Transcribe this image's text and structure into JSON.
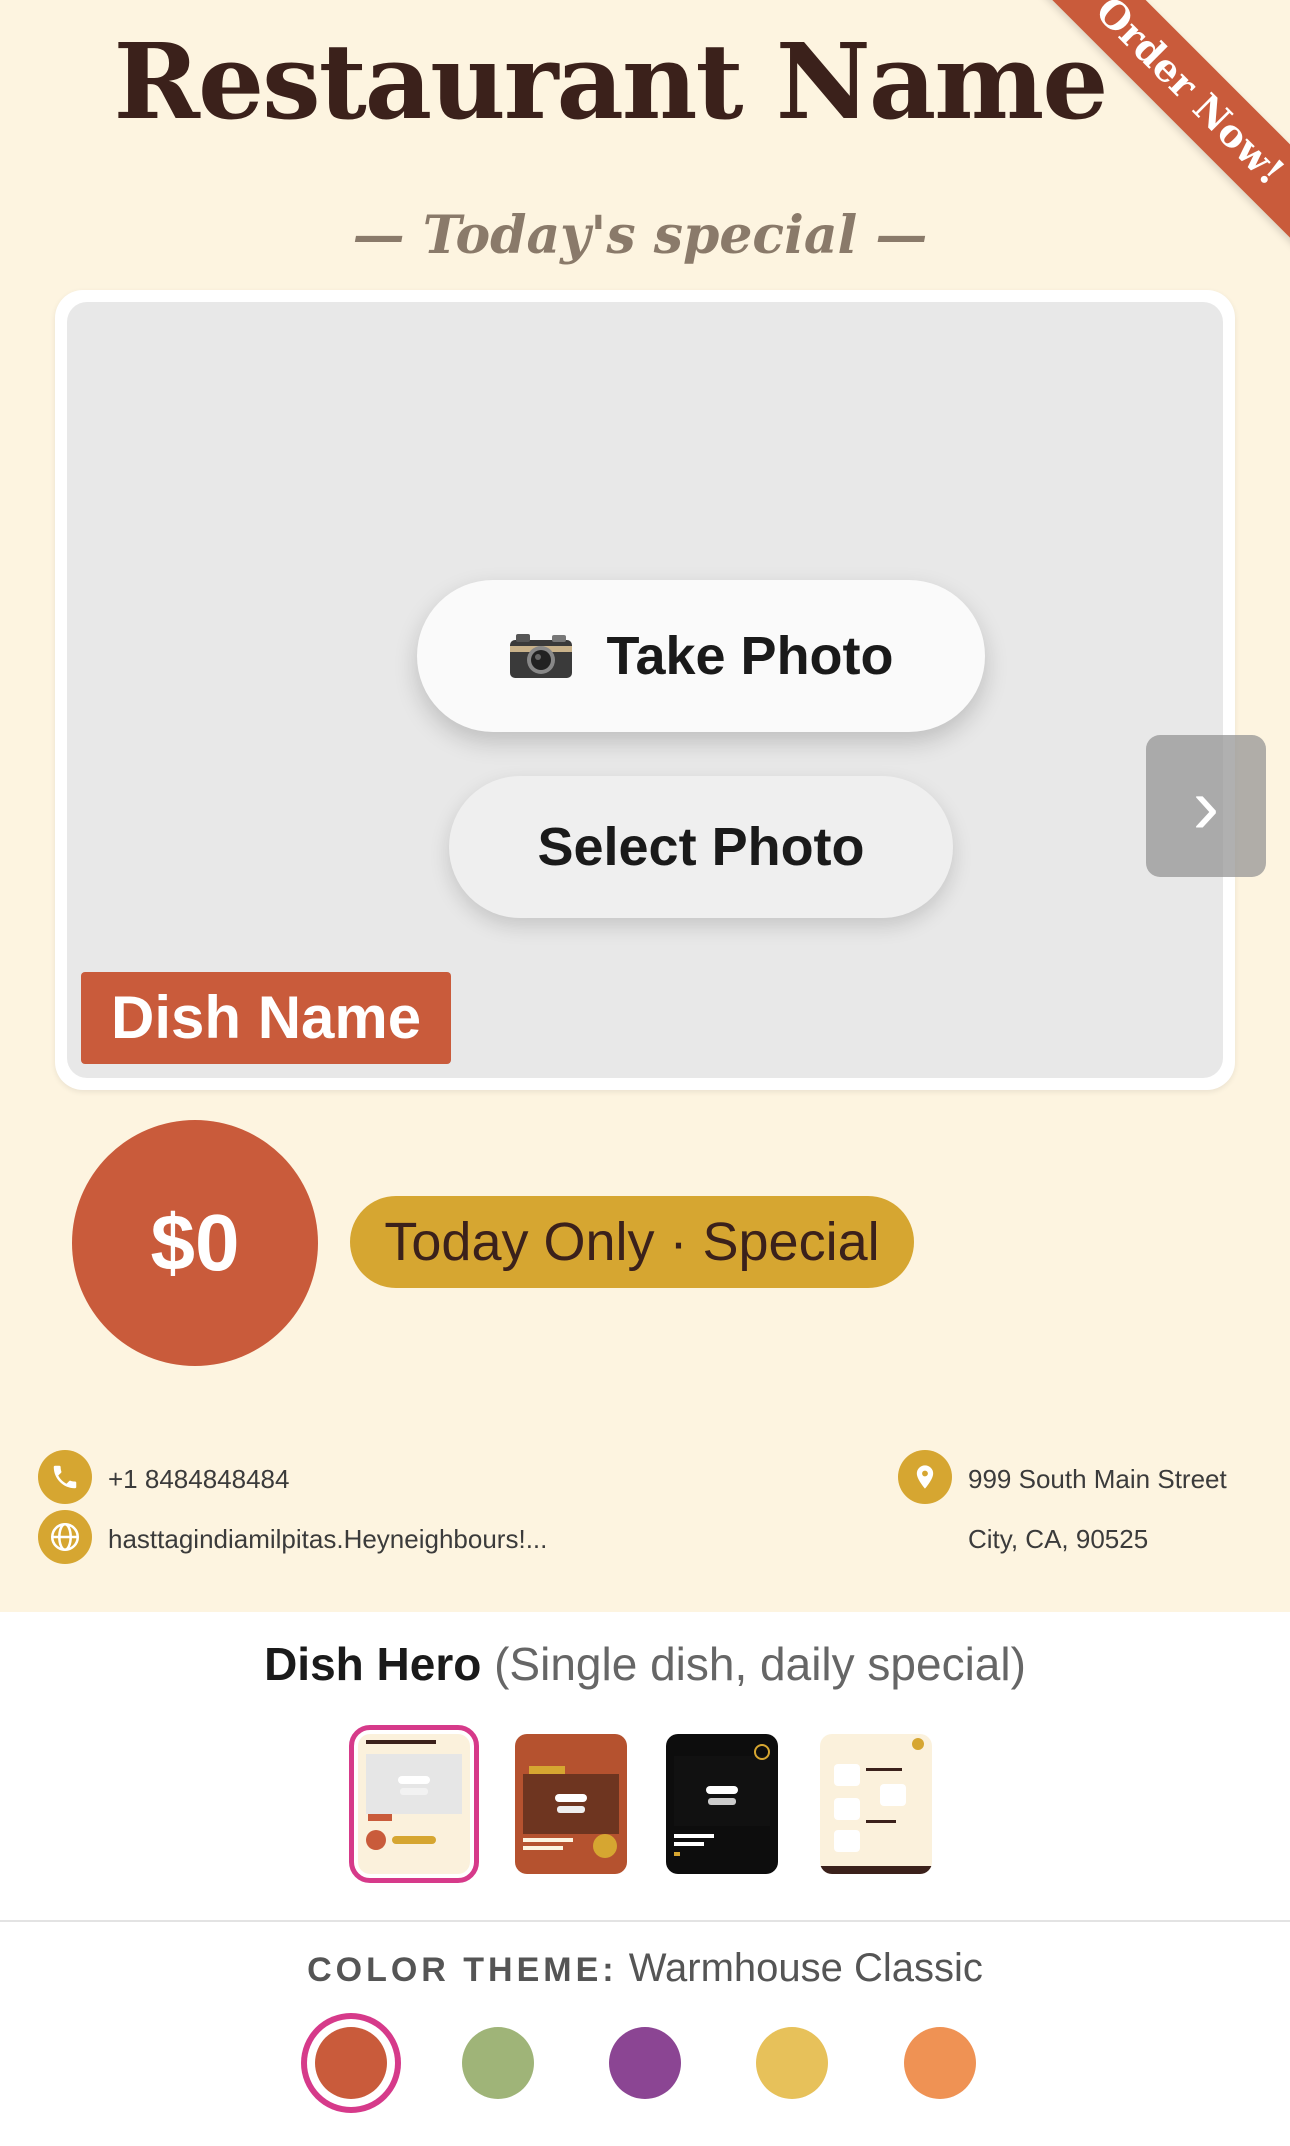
{
  "poster": {
    "restaurant_name": "Restaurant Name",
    "ribbon": "Order Now!",
    "subtitle": "— Today's special —",
    "take_photo": "Take Photo",
    "select_photo": "Select Photo",
    "dish_name": "Dish Name",
    "next_icon": "›",
    "price": "$0",
    "badge": "Today Only · Special",
    "phone": "+1 8484848484",
    "website": "hasttagindiamilpitas.Heyneighbours!...",
    "address_line1": "999 South Main Street",
    "address_line2": "City, CA, 90525"
  },
  "templates": {
    "name": "Dish Hero",
    "description": "(Single dish, daily special)",
    "selected_index": 0
  },
  "theme": {
    "label": "COLOR THEME:",
    "name": "Warmhouse Classic",
    "swatches": [
      "#c95b3b",
      "#9fb478",
      "#8b4593",
      "#e7c15a",
      "#ef9254"
    ],
    "selected_index": 0
  },
  "colors": {
    "accent": "#c95b3b",
    "gold": "#d6a631",
    "cream": "#fdf4e0",
    "selection": "#d63a8a"
  }
}
